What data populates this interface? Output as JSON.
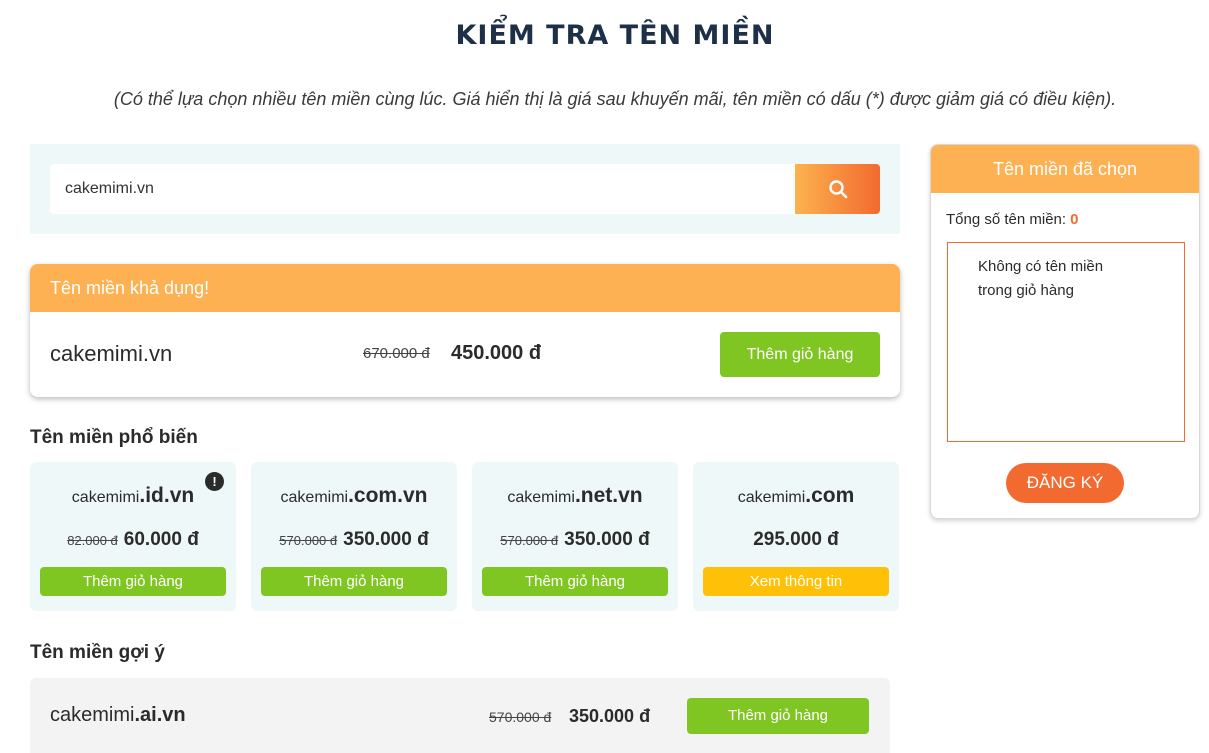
{
  "page": {
    "title": "KIỂM TRA TÊN MIỀN",
    "subtitle": "(Có thể lựa chọn nhiều tên miền cùng lúc. Giá hiển thị là giá sau khuyến mãi, tên miền có dấu (*) được giảm giá có điều kiện)."
  },
  "search": {
    "value": "cakemimi.vn",
    "button_icon": "search-icon"
  },
  "available": {
    "header": "Tên miền khả dụng!",
    "domain": "cakemimi.vn",
    "old_price": "670.000 đ",
    "new_price": "450.000 đ",
    "button": "Thêm giỏ hàng"
  },
  "popular": {
    "label": "Tên miền phổ biến",
    "items": [
      {
        "name": "cakemimi",
        "ext": ".id.vn",
        "old_price": "82.000 đ",
        "new_price": "60.000 đ",
        "button": "Thêm giỏ hàng",
        "info_icon": "!"
      },
      {
        "name": "cakemimi",
        "ext": ".com.vn",
        "old_price": "570.000 đ",
        "new_price": "350.000 đ",
        "button": "Thêm giỏ hàng"
      },
      {
        "name": "cakemimi",
        "ext": ".net.vn",
        "old_price": "570.000 đ",
        "new_price": "350.000 đ",
        "button": "Thêm giỏ hàng"
      },
      {
        "name": "cakemimi",
        "ext": ".com",
        "old_price": "",
        "new_price": "295.000 đ",
        "button": "Xem thông tin"
      }
    ]
  },
  "suggested": {
    "label": "Tên miền gợi ý",
    "items": [
      {
        "name": "cakemimi",
        "ext": ".ai.vn",
        "old_price": "570.000 đ",
        "new_price": "350.000 đ",
        "button": "Thêm giỏ hàng"
      }
    ]
  },
  "cart": {
    "header": "Tên miền đã chọn",
    "total_label": "Tổng số tên miền:",
    "total_count": "0",
    "empty_line1": "Không có tên miền",
    "empty_line2": "trong giỏ hàng",
    "register": "ĐĂNG KÝ"
  },
  "colors": {
    "accent_orange": "#fdb153",
    "brand_orange": "#f26a2f",
    "green": "#80c623",
    "yellow": "#ffc107",
    "title_navy": "#1d3047"
  }
}
